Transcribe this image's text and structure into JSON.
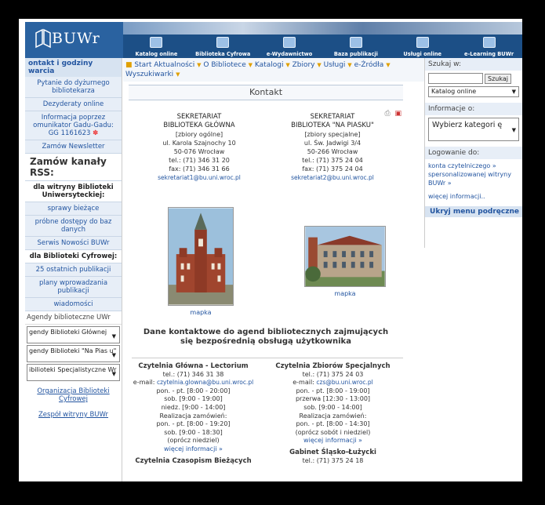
{
  "header": {
    "logo": "BUWr",
    "nav": [
      "Katalog online",
      "Biblioteka Cyfrowa",
      "e-Wydawnictwo",
      "Baza publikacji",
      "Usługi online",
      "e-Learning BUWr"
    ]
  },
  "left_sidebar": {
    "heading": "ontakt i godziny warcia",
    "items": [
      "Pytanie do dyżurnego bibliotekarza",
      "Dezyderaty online",
      "Informacja poprzez omunikator Gadu-Gadu: GG 1161623",
      "Zamów Newsletter"
    ],
    "rss_heading": "Zamów kanały RSS:",
    "rss_uwr_label": "dla witryny Biblioteki Uniwersyteckiej:",
    "rss_uwr_items": [
      "sprawy bieżące",
      "próbne dostępy do baz danych",
      "Serwis Nowości BUWr"
    ],
    "rss_bc_label": "dla Biblioteki Cyfrowej:",
    "rss_bc_items": [
      "25 ostatnich publikacji",
      "plany wprowadzania publikacji",
      "wiadomości"
    ],
    "agendy_label": "Agendy biblioteczne UWr",
    "agendy_selects": [
      "gendy Biblioteki Głównej",
      "gendy Biblioteki \"Na Pias u\"",
      "ibilioteki Specjalistyczne Wr"
    ],
    "link_org": "Organizacja Biblioteki Cyfrowej",
    "link_team": "Zespół witryny BUWr"
  },
  "menu": {
    "items": [
      "Start",
      "Aktualności",
      "O Bibliotece",
      "Katalogi",
      "Zbiory",
      "Usługi",
      "e-Źródła",
      "Wyszukiwarki"
    ]
  },
  "content": {
    "title": "Kontakt",
    "col_left": {
      "h1": "SEKRETARIAT",
      "h2": "BIBLIOTEKA GŁÓWNA",
      "lines": [
        "[zbiory ogólne]",
        "ul. Karola Szajnochy 10",
        "50-076 Wrocław",
        "tel.: (71) 346 31 20",
        "fax: (71) 346 31 66"
      ],
      "mail": "sekretariat1@bu.uni.wroc.pl",
      "map": "mapka"
    },
    "col_right": {
      "h1": "SEKRETARIAT",
      "h2": "BIBLIOTEKA \"NA PIASKU\"",
      "lines": [
        "[zbiory specjalne]",
        "ul. Św. Jadwigi 3/4",
        "50-266 Wrocław",
        "tel.: (71) 375 24 04",
        "fax: (71) 375 24 04"
      ],
      "mail": "sekretariat2@bu.uni.wroc.pl",
      "map": "mapka"
    },
    "agend_title": "Dane kontaktowe do agend bibliotecznych zajmujących się bezpośrednią obsługą użytkownika",
    "reading_left": {
      "title": "Czytelnia Główna - Lectorium",
      "tel": "tel.: (71) 346 31 38",
      "mail_label": "e-mail:",
      "mail": "czytelnia.glowna@bu.uni.wroc.pl",
      "lines": [
        "pon. - pt. [8:00 - 20:00]",
        "sob. [9:00 - 19:00]",
        "niedz. [9:00 - 14:00]",
        "Realizacja zamówień:",
        "pon. - pt. [8:00 - 19:20]",
        "sob. [9:00 - 18:30]",
        "(oprócz niedziel)"
      ],
      "more": "więcej informacji »",
      "next": "Czytelnia Czasopism Bieżących"
    },
    "reading_right": {
      "title": "Czytelnia Zbiorów Specjalnych",
      "tel": "tel.: (71) 375 24 03",
      "mail_label": "e-mail:",
      "mail": "czs@bu.uni.wroc.pl",
      "lines": [
        "pon. - pt. [8:00 - 19:00]",
        "przerwa [12:30 - 13:00]",
        "sob. [9:00 - 14:00]",
        "Realizacja zamówień:",
        "pon. - pt. [8:00 - 14:30]",
        "(oprócz sobót i niedziel)"
      ],
      "more": "więcej informacji »",
      "next": "Gabinet Śląsko-Łużycki",
      "next_tel": "tel.: (71) 375 24 18"
    }
  },
  "right_sidebar": {
    "search_label": "Szukaj w:",
    "search_button": "Szukaj",
    "search_select": "Katalog online",
    "info_label": "Informacje o:",
    "info_select": "Wybierz kategori ę",
    "login_label": "Logowanie do:",
    "login_link": "konta czytelniczego » spersonalizowanej witryny BUWr »",
    "more": "więcej informacji..",
    "hide_menu": "Ukryj menu podręczne"
  }
}
